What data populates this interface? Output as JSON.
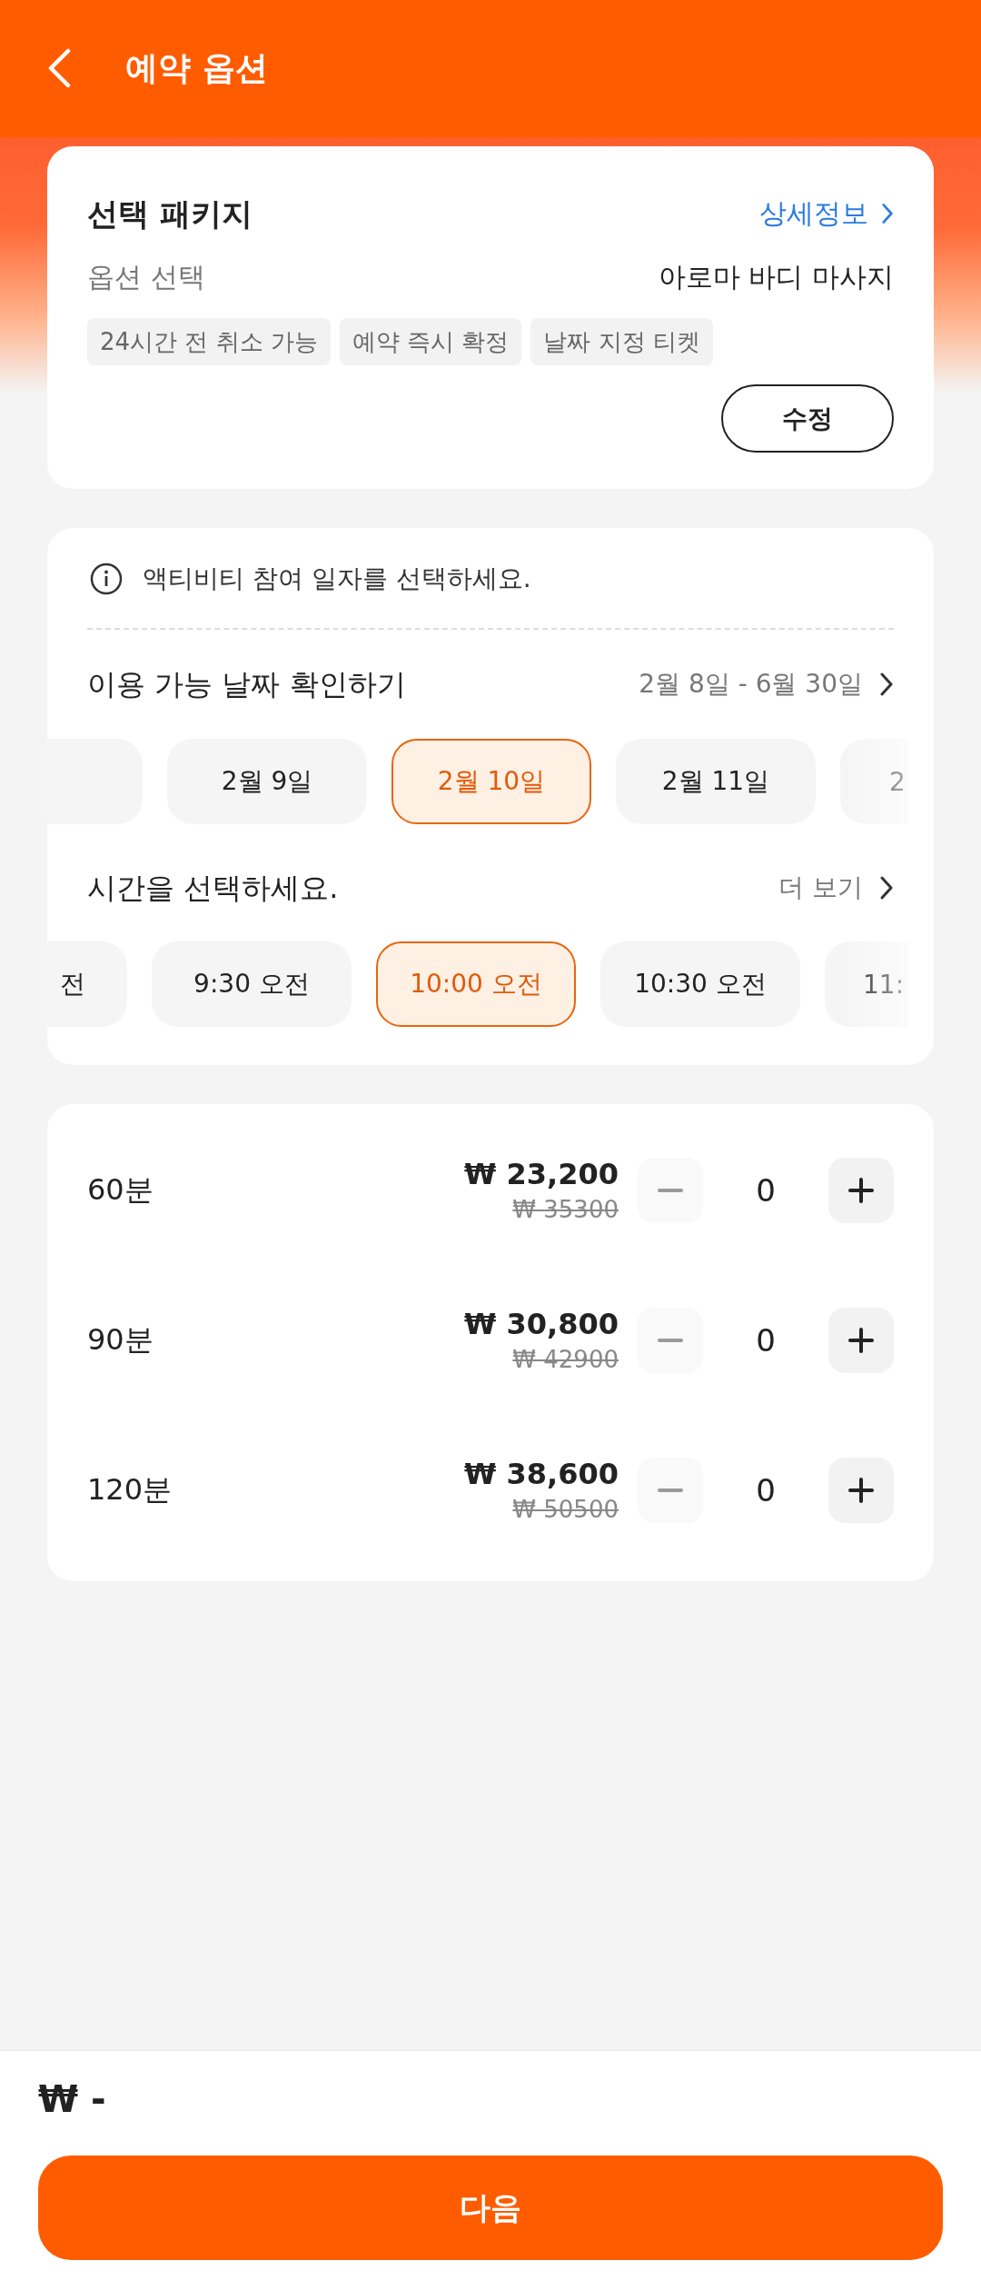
{
  "header": {
    "title": "예약 옵션"
  },
  "package": {
    "title": "선택 패키지",
    "details_link": "상세정보",
    "option_label": "옵션 선택",
    "option_value": "아로마 바디 마사지",
    "tags": [
      "24시간 전 취소 가능",
      "예약 즉시 확정",
      "날짜 지정 티켓"
    ],
    "edit_button": "수정"
  },
  "schedule": {
    "notice": "액티비티 참여 일자를 선택하세요.",
    "date_heading": "이용 가능 날짜 확인하기",
    "date_range": "2월 8일 - 6월 30일",
    "dates": [
      {
        "selected": false
      },
      {
        "label": "2월 9일",
        "selected": false
      },
      {
        "label": "2월 10일",
        "selected": true
      },
      {
        "label": "2월 11일",
        "selected": false
      },
      {
        "label": "2",
        "selected": false
      }
    ],
    "time_heading": "시간을 선택하세요.",
    "more_link": "더 보기",
    "times": [
      {
        "label": "전",
        "selected": false
      },
      {
        "label": "9:30 오전",
        "selected": false
      },
      {
        "label": "10:00 오전",
        "selected": true
      },
      {
        "label": "10:30 오전",
        "selected": false
      },
      {
        "label": "11:",
        "selected": false
      }
    ]
  },
  "options": [
    {
      "name": "60분",
      "price": "₩ 23,200",
      "original_price": "₩ 35300",
      "quantity": "0",
      "decrease_disabled": true
    },
    {
      "name": "90분",
      "price": "₩ 30,800",
      "original_price": "₩ 42900",
      "quantity": "0",
      "decrease_disabled": true
    },
    {
      "name": "120분",
      "price": "₩ 38,600",
      "original_price": "₩ 50500",
      "quantity": "0",
      "decrease_disabled": true
    }
  ],
  "footer": {
    "total": "₩ -",
    "next_button": "다음"
  }
}
